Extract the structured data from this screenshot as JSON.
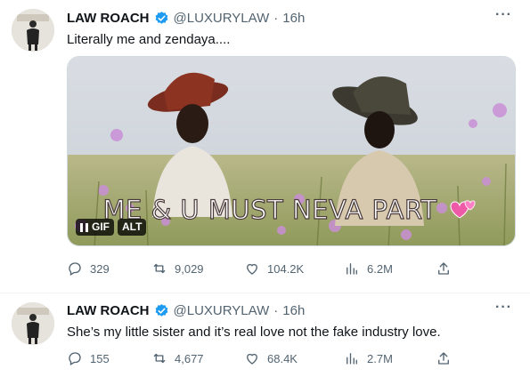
{
  "tweets": [
    {
      "name": "LAW ROACH",
      "handle": "@LUXURYLAW",
      "separator": "·",
      "time": "16h",
      "text": "Literally me and zendaya....",
      "media": {
        "caption": "ME & U MUST NEVA PART",
        "badges": {
          "gif": "GIF",
          "alt": "ALT"
        }
      },
      "stats": {
        "replies": "329",
        "retweets": "9,029",
        "likes": "104.2K",
        "views": "6.2M"
      }
    },
    {
      "name": "LAW ROACH",
      "handle": "@LUXURYLAW",
      "separator": "·",
      "time": "16h",
      "text": "She’s my little sister and it’s real love not the fake industry love.",
      "stats": {
        "replies": "155",
        "retweets": "4,677",
        "likes": "68.4K",
        "views": "2.7M"
      }
    }
  ],
  "icons": {
    "verified": "verified-badge-icon",
    "more": "more-options-icon",
    "reply": "reply-icon",
    "retweet": "retweet-icon",
    "like": "heart-icon",
    "views": "views-icon",
    "share": "share-icon",
    "pause": "pause-icon",
    "caption_heart": "heart-emoji-icon"
  },
  "colors": {
    "verified": "#1d9bf0",
    "secondary_text": "#536471",
    "divider": "#eff3f4"
  },
  "more_glyph": "···"
}
